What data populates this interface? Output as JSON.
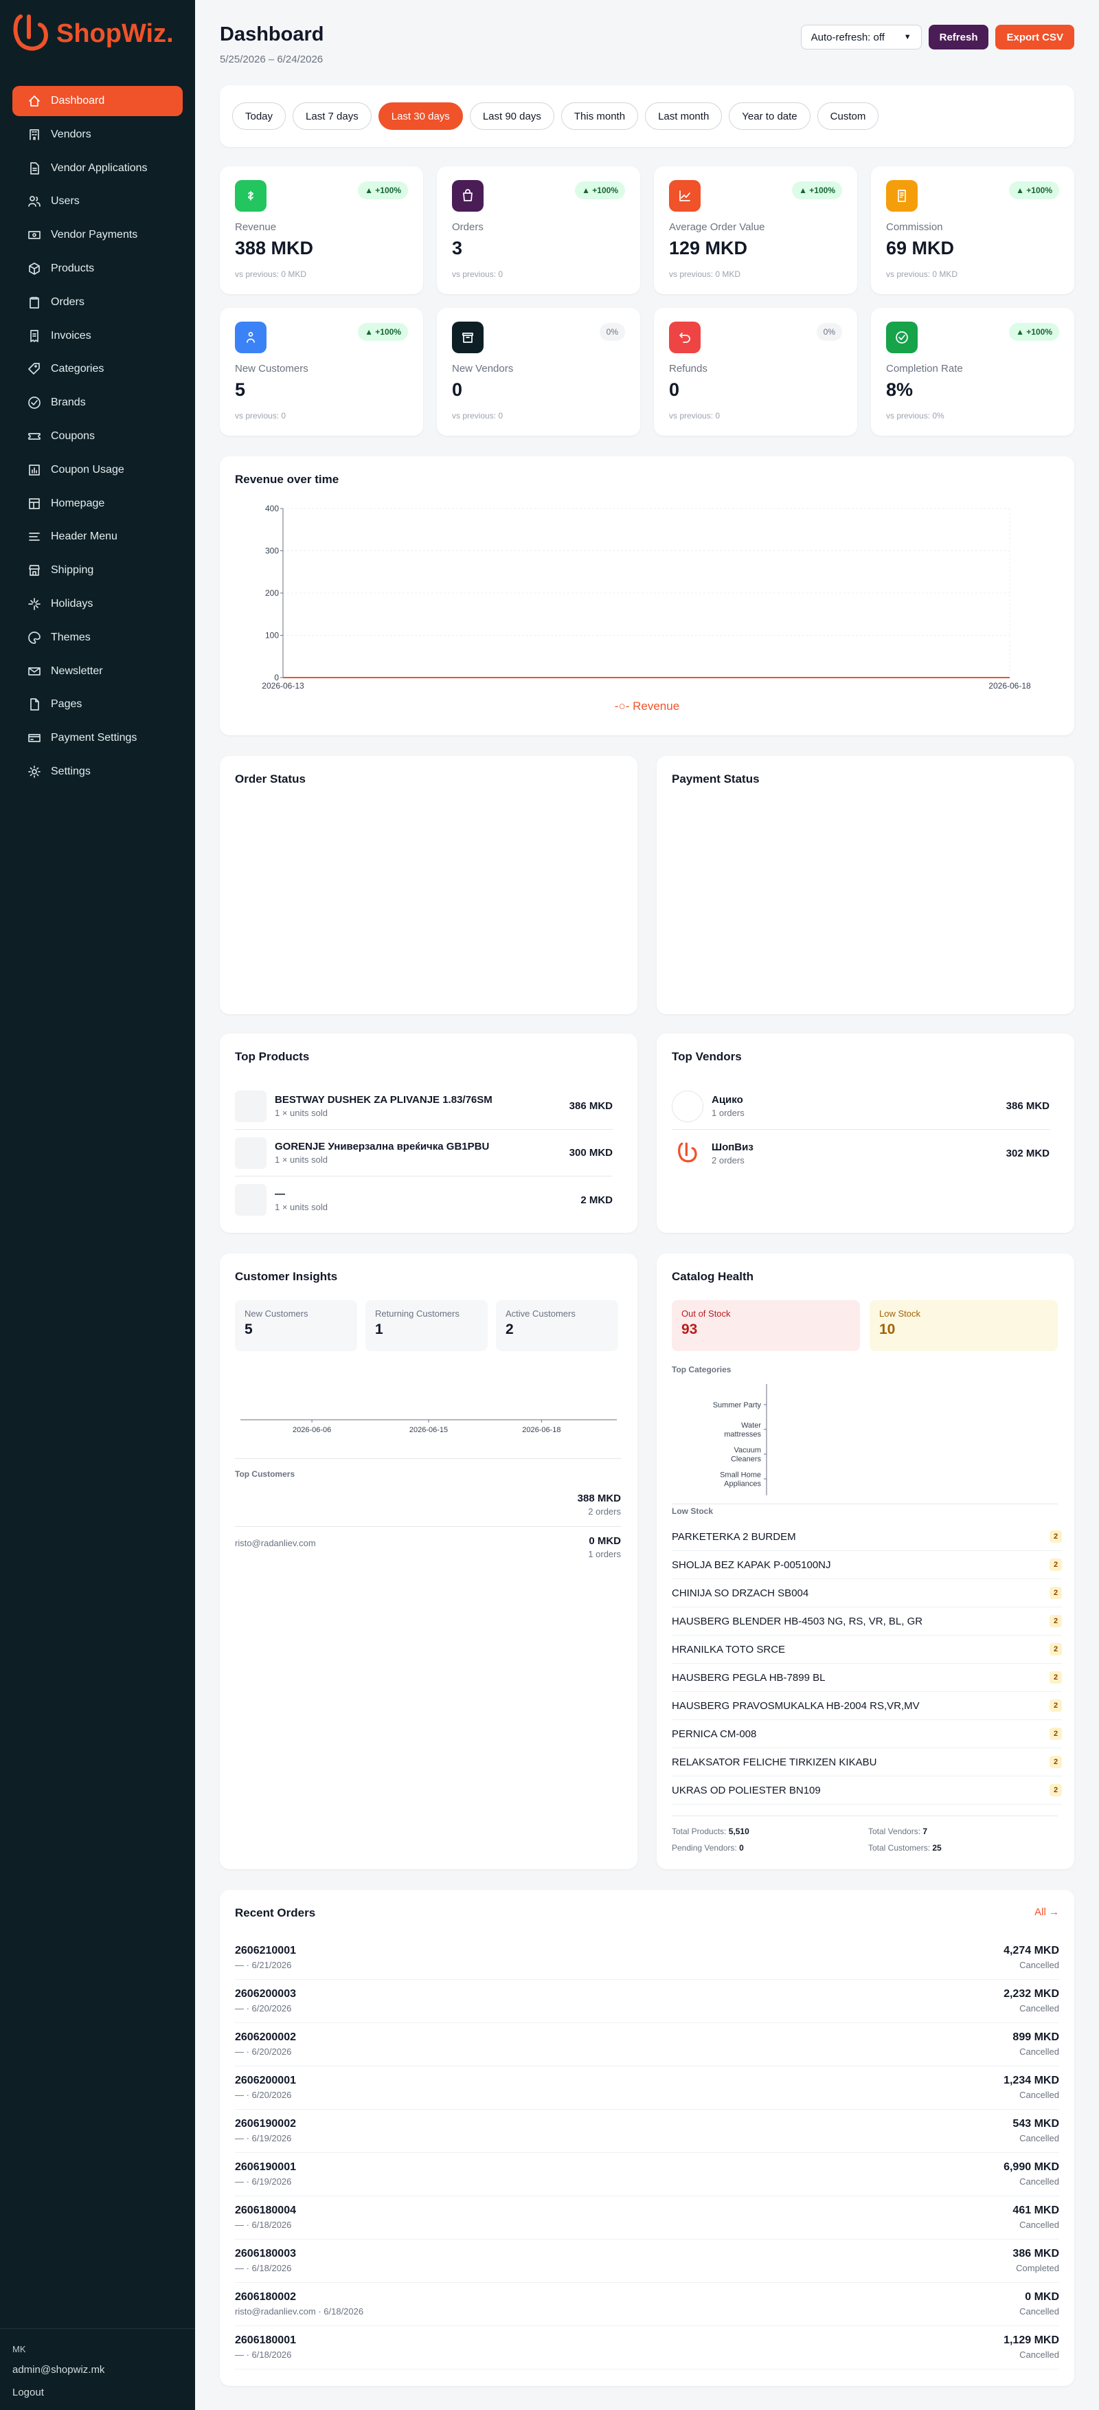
{
  "brand": {
    "name": "ShopWiz.",
    "color": "#f0522a"
  },
  "sidebar": {
    "items": [
      {
        "label": "Dashboard",
        "icon": "home-icon",
        "active": true
      },
      {
        "label": "Vendors",
        "icon": "building-icon"
      },
      {
        "label": "Vendor Applications",
        "icon": "document-icon"
      },
      {
        "label": "Users",
        "icon": "users-icon"
      },
      {
        "label": "Vendor Payments",
        "icon": "cash-icon"
      },
      {
        "label": "Products",
        "icon": "box-icon"
      },
      {
        "label": "Orders",
        "icon": "clipboard-icon"
      },
      {
        "label": "Invoices",
        "icon": "invoice-icon"
      },
      {
        "label": "Categories",
        "icon": "tag-icon"
      },
      {
        "label": "Brands",
        "icon": "badge-check-icon"
      },
      {
        "label": "Coupons",
        "icon": "ticket-icon"
      },
      {
        "label": "Coupon Usage",
        "icon": "chart-bar-icon"
      },
      {
        "label": "Homepage",
        "icon": "layout-icon"
      },
      {
        "label": "Header Menu",
        "icon": "menu-icon"
      },
      {
        "label": "Shipping",
        "icon": "store-icon"
      },
      {
        "label": "Holidays",
        "icon": "sparkle-icon"
      },
      {
        "label": "Themes",
        "icon": "palette-icon"
      },
      {
        "label": "Newsletter",
        "icon": "mail-icon"
      },
      {
        "label": "Pages",
        "icon": "page-icon"
      },
      {
        "label": "Payment Settings",
        "icon": "credit-card-icon"
      },
      {
        "label": "Settings",
        "icon": "gear-icon"
      }
    ],
    "footer": {
      "locale": "MK",
      "email": "admin@shopwiz.mk",
      "logout": "Logout"
    }
  },
  "header": {
    "title": "Dashboard",
    "date_range": "5/25/2026 – 6/24/2026",
    "auto_refresh": "Auto-refresh: off",
    "refresh": "Refresh",
    "export": "Export CSV"
  },
  "periods": [
    "Today",
    "Last 7 days",
    "Last 30 days",
    "Last 90 days",
    "This month",
    "Last month",
    "Year to date",
    "Custom"
  ],
  "active_period": "Last 30 days",
  "kpis": [
    {
      "label": "Revenue",
      "value": "388 MKD",
      "change": "▲ +100%",
      "prev": "vs previous: 0 MKD",
      "color": "#22c55e",
      "icon": "currency-icon",
      "trend": "up"
    },
    {
      "label": "Orders",
      "value": "3",
      "change": "▲ +100%",
      "prev": "vs previous: 0",
      "color": "#4b1d56",
      "icon": "shopping-bag-icon",
      "trend": "up"
    },
    {
      "label": "Average Order Value",
      "value": "129 MKD",
      "change": "▲ +100%",
      "prev": "vs previous: 0 MKD",
      "color": "#f0522a",
      "icon": "trend-chart-icon",
      "trend": "up"
    },
    {
      "label": "Commission",
      "value": "69 MKD",
      "change": "▲ +100%",
      "prev": "vs previous: 0 MKD",
      "color": "#f59e0b",
      "icon": "receipt-icon",
      "trend": "up"
    },
    {
      "label": "New Customers",
      "value": "5",
      "change": "▲ +100%",
      "prev": "vs previous: 0",
      "color": "#3b82f6",
      "icon": "user-group-icon",
      "trend": "up"
    },
    {
      "label": "New Vendors",
      "value": "0",
      "change": "0%",
      "prev": "vs previous: 0",
      "color": "#0d1f24",
      "icon": "archive-icon",
      "trend": "flat"
    },
    {
      "label": "Refunds",
      "value": "0",
      "change": "0%",
      "prev": "vs previous: 0",
      "color": "#ef4444",
      "icon": "return-arrow-icon",
      "trend": "flat"
    },
    {
      "label": "Completion Rate",
      "value": "8%",
      "change": "▲ +100%",
      "prev": "vs previous: 0%",
      "color": "#16a34a",
      "icon": "check-circle-icon",
      "trend": "up"
    }
  ],
  "revenue_chart": {
    "title": "Revenue over time",
    "legend": "Revenue",
    "color": "#f0522a"
  },
  "chart_data": [
    {
      "type": "line",
      "title": "Revenue over time",
      "x": [
        "2026-06-13",
        "2026-06-18"
      ],
      "series": [
        {
          "name": "Revenue",
          "values": [
            0,
            0
          ]
        }
      ],
      "ylim": [
        0,
        400
      ],
      "yticks": [
        0,
        100,
        200,
        300,
        400
      ],
      "grid": true,
      "legend": "bottom"
    },
    {
      "type": "line",
      "title": "",
      "x": [
        "2026-06-06",
        "2026-06-15",
        "2026-06-18"
      ],
      "series": [
        {
          "values": [
            0,
            0,
            0
          ]
        }
      ],
      "grid": false
    },
    {
      "type": "bar",
      "title": "Top Categories",
      "categories": [
        "Summer Party",
        "Water mattresses",
        "Vacuum Cleaners",
        "Small Home Appliances"
      ],
      "orientation": "horizontal",
      "values": [
        0,
        0,
        0,
        0
      ],
      "grid": false
    }
  ],
  "order_status": {
    "title": "Order Status"
  },
  "payment_status": {
    "title": "Payment Status"
  },
  "top_products": {
    "title": "Top Products",
    "items": [
      {
        "name": "BESTWAY DUSHEK ZA PLIVANJE 1.83/76SM",
        "sub": "1 × units sold",
        "amount": "386 MKD"
      },
      {
        "name": "GORENJE Универзална вреќичка GB1PBU",
        "sub": "1 × units sold",
        "amount": "300 MKD"
      },
      {
        "name": "—",
        "sub": "1 × units sold",
        "amount": "2 MKD"
      }
    ]
  },
  "top_vendors": {
    "title": "Top Vendors",
    "items": [
      {
        "name": "Ацико",
        "sub": "1 orders",
        "amount": "386 MKD"
      },
      {
        "name": "ШопВиз",
        "sub": "2 orders",
        "amount": "302 MKD"
      }
    ]
  },
  "customer_insights": {
    "title": "Customer Insights",
    "stats": [
      {
        "label": "New Customers",
        "value": "5"
      },
      {
        "label": "Returning Customers",
        "value": "1"
      },
      {
        "label": "Active Customers",
        "value": "2"
      }
    ],
    "ticks": [
      "2026-06-06",
      "2026-06-15",
      "2026-06-18"
    ],
    "top_title": "Top Customers",
    "customers": [
      {
        "email": "",
        "amount": "388 MKD",
        "orders": "2 orders"
      },
      {
        "email": "risto@radanliev.com",
        "amount": "0 MKD",
        "orders": "1 orders"
      }
    ]
  },
  "catalog": {
    "title": "Catalog Health",
    "out_label": "Out of Stock",
    "out_value": "93",
    "low_label": "Low Stock",
    "low_value": "10",
    "cat_title": "Top Categories",
    "categories": [
      "Summer Party",
      "Water mattresses",
      "Vacuum Cleaners",
      "Small Home Appliances"
    ],
    "low_title": "Low Stock",
    "low_items": [
      {
        "name": "PARKETERKA 2 BURDEM",
        "qty": "2"
      },
      {
        "name": "SHOLJA BEZ KAPAK P-005100NJ",
        "qty": "2"
      },
      {
        "name": "CHINIJA SO DRZACH SB004",
        "qty": "2"
      },
      {
        "name": "HAUSBERG BLENDER HB-4503 NG, RS, VR, BL, GR",
        "qty": "2"
      },
      {
        "name": "HRANILKA TOTO SRCE",
        "qty": "2"
      },
      {
        "name": "HAUSBERG PEGLA HB-7899 BL",
        "qty": "2"
      },
      {
        "name": "HAUSBERG PRAVOSMUKALKA HB-2004 RS,VR,MV",
        "qty": "2"
      },
      {
        "name": "PERNICA CM-008",
        "qty": "2"
      },
      {
        "name": "RELAKSATOR FELICHE TIRKIZEN KIKABU",
        "qty": "2"
      },
      {
        "name": "UKRAS OD POLIESTER BN109",
        "qty": "2"
      }
    ],
    "total_products_label": "Total Products:",
    "total_products": "5,510",
    "total_vendors_label": "Total Vendors:",
    "total_vendors": "7",
    "pending_label": "Pending Vendors:",
    "pending": "0",
    "total_customers_label": "Total Customers:",
    "total_customers": "25"
  },
  "recent_orders": {
    "title": "Recent Orders",
    "all": "All →",
    "items": [
      {
        "id": "2606210001",
        "meta": "— · 6/21/2026",
        "amount": "4,274 MKD",
        "status": "Cancelled"
      },
      {
        "id": "2606200003",
        "meta": "— · 6/20/2026",
        "amount": "2,232 MKD",
        "status": "Cancelled"
      },
      {
        "id": "2606200002",
        "meta": "— · 6/20/2026",
        "amount": "899 MKD",
        "status": "Cancelled"
      },
      {
        "id": "2606200001",
        "meta": "— · 6/20/2026",
        "amount": "1,234 MKD",
        "status": "Cancelled"
      },
      {
        "id": "2606190002",
        "meta": "— · 6/19/2026",
        "amount": "543 MKD",
        "status": "Cancelled"
      },
      {
        "id": "2606190001",
        "meta": "— · 6/19/2026",
        "amount": "6,990 MKD",
        "status": "Cancelled"
      },
      {
        "id": "2606180004",
        "meta": "— · 6/18/2026",
        "amount": "461 MKD",
        "status": "Cancelled"
      },
      {
        "id": "2606180003",
        "meta": "— · 6/18/2026",
        "amount": "386 MKD",
        "status": "Completed"
      },
      {
        "id": "2606180002",
        "meta": "risto@radanliev.com · 6/18/2026",
        "amount": "0 MKD",
        "status": "Cancelled"
      },
      {
        "id": "2606180001",
        "meta": "— · 6/18/2026",
        "amount": "1,129 MKD",
        "status": "Cancelled"
      }
    ]
  }
}
